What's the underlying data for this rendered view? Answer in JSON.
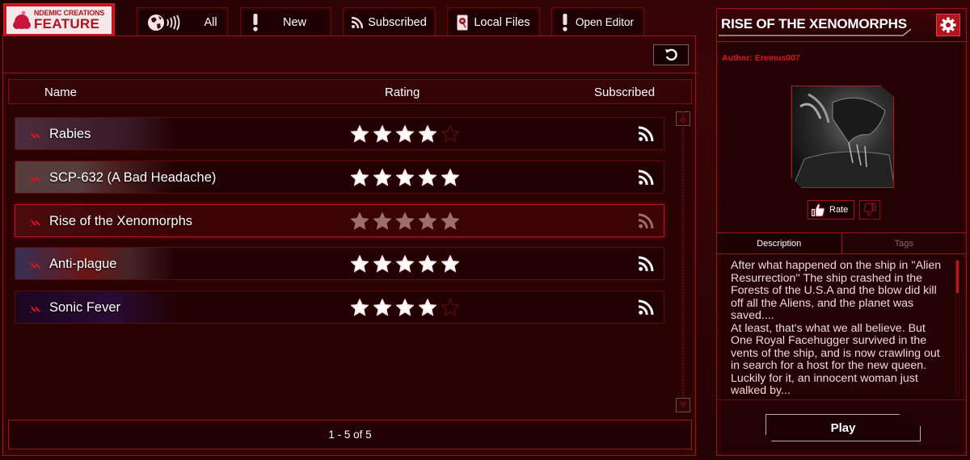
{
  "brand": {
    "top": "NDEMIC CREATIONS",
    "bottom": "FEATURE"
  },
  "tabs": [
    {
      "label": "All",
      "icon": "globe-broadcast-icon"
    },
    {
      "label": "New",
      "icon": "exclamation-icon"
    },
    {
      "label": "Subscribed",
      "icon": "rss-icon"
    },
    {
      "label": "Local Files",
      "icon": "hard-drive-icon"
    },
    {
      "label": "Open Editor",
      "icon": "exclamation-icon"
    }
  ],
  "list": {
    "headers": {
      "name": "Name",
      "rating": "Rating",
      "subscribed": "Subscribed"
    },
    "rows": [
      {
        "name": "Rabies",
        "rating": 4,
        "subscribed": true,
        "selected": false
      },
      {
        "name": "SCP-632 (A Bad Headache)",
        "rating": 5,
        "subscribed": true,
        "selected": false
      },
      {
        "name": "Rise of the Xenomorphs",
        "rating": 5,
        "subscribed": true,
        "selected": true
      },
      {
        "name": "Anti-plague",
        "rating": 5,
        "subscribed": true,
        "selected": false
      },
      {
        "name": "Sonic Fever",
        "rating": 4,
        "subscribed": true,
        "selected": false
      }
    ],
    "pager": "1 - 5 of 5"
  },
  "detail": {
    "title": "RISE OF THE XENOMORPHS",
    "author": "Author: Eremus007",
    "rate_label": "Rate",
    "tabs": {
      "description": "Description",
      "tags": "Tags"
    },
    "description": "After what happened on the ship in ''Alien Resurrection'' The ship crashed in the Forests of the U.S.A and the blow did kill off all the Aliens, and the planet was saved....\nAt least, that's what we all believe. But One Royal Facehugger survived in the vents of the ship, and is now crawling out in search for a host for the new queen.\nLuckily for it, an innocent woman just walked by...",
    "play_label": "Play"
  },
  "colors": {
    "accent": "#c8141c",
    "background": "#2a0204",
    "author": "#e0141c"
  }
}
